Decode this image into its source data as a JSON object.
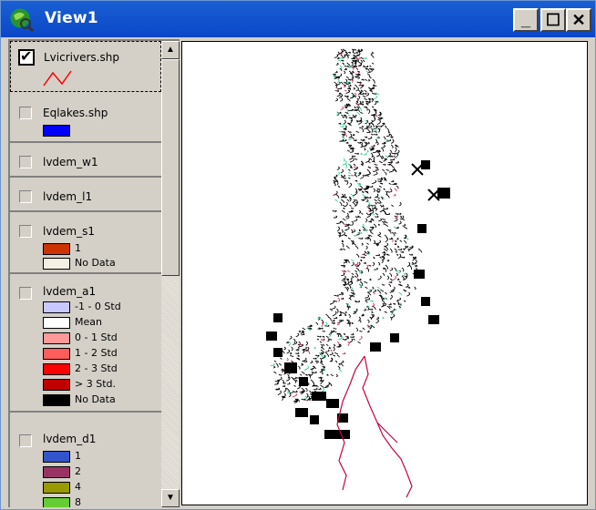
{
  "window": {
    "title": "View1",
    "min_glyph": "_",
    "max_glyph": "☐",
    "close_glyph": "✕"
  },
  "toc": {
    "themes": [
      {
        "name": "Lvicrivers.shp",
        "checked": true,
        "legend": []
      },
      {
        "name": "Eqlakes.shp",
        "checked": false,
        "legend": []
      },
      {
        "name": "lvdem_w1",
        "checked": false,
        "legend": []
      },
      {
        "name": "lvdem_l1",
        "checked": false,
        "legend": []
      },
      {
        "name": "lvdem_s1",
        "checked": false,
        "legend": [
          {
            "label": "1",
            "color": "#cc3300"
          },
          {
            "label": "No Data",
            "color": "#f4f0e4"
          }
        ]
      },
      {
        "name": "lvdem_a1",
        "checked": false,
        "legend": [
          {
            "label": "-1 - 0 Std",
            "color": "#c8c8ff"
          },
          {
            "label": "Mean",
            "color": "#ffffff"
          },
          {
            "label": "0 - 1 Std",
            "color": "#ff9999"
          },
          {
            "label": "1 - 2 Std",
            "color": "#ff5c5c"
          },
          {
            "label": "2 - 3 Std",
            "color": "#ff0000"
          },
          {
            "label": "> 3 Std.",
            "color": "#c00000"
          },
          {
            "label": "No Data",
            "color": "#000000"
          }
        ]
      },
      {
        "name": "lvdem_d1",
        "checked": false,
        "legend": [
          {
            "label": "1",
            "color": "#3355cc"
          },
          {
            "label": "2",
            "color": "#993366"
          },
          {
            "label": "4",
            "color": "#999900"
          },
          {
            "label": "8",
            "color": "#66cc33"
          }
        ]
      }
    ]
  },
  "colors": {
    "river_symbol": "#ff0000",
    "lake_fill": "#0000ff",
    "river_track": "#cc0044"
  }
}
